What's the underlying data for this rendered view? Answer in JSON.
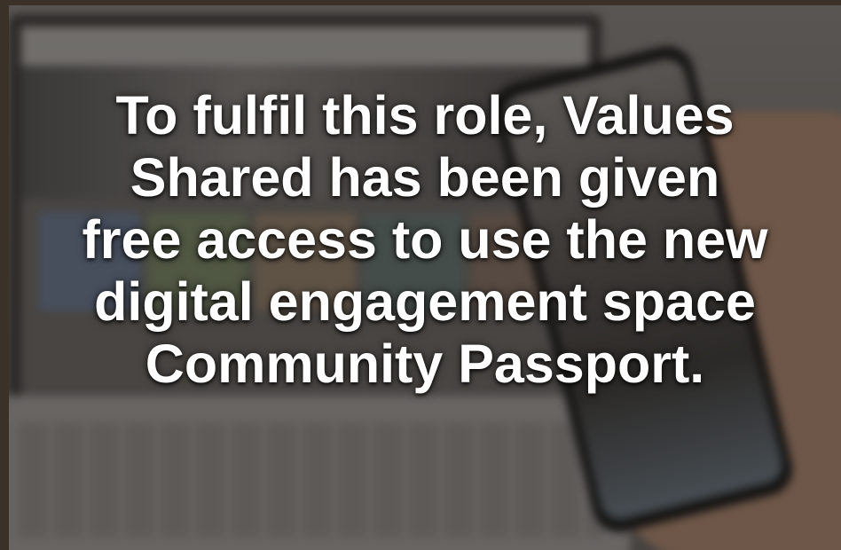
{
  "caption": {
    "lines": [
      "To fulfil this role, Values",
      "Shared has been given",
      "free access to use the new",
      "digital engagement space",
      "Community Passport."
    ]
  },
  "colors": {
    "text": "#ffffff",
    "border": "#3a3128"
  }
}
